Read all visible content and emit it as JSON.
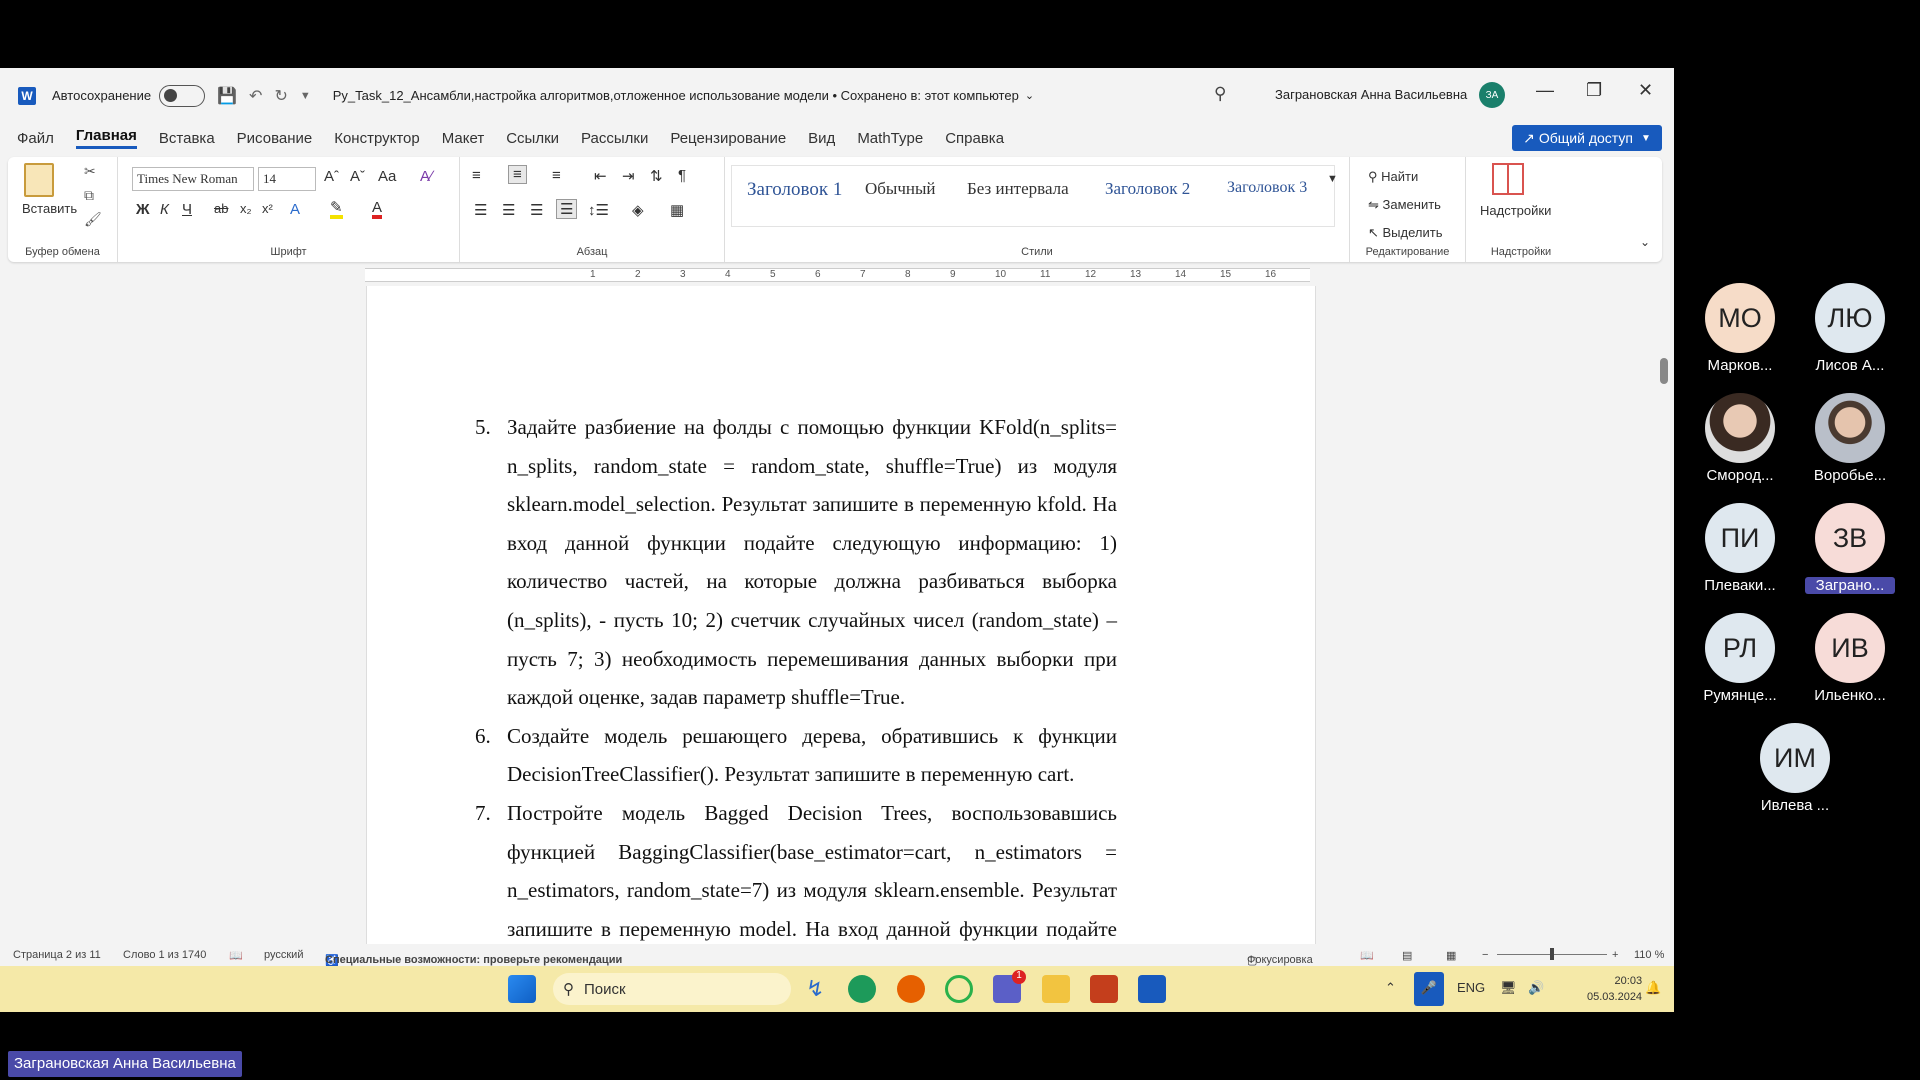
{
  "titlebar": {
    "app_icon": "W",
    "autosave_label": "Автосохранение",
    "doc_title": "Py_Task_12_Ансамбли,настройка алгоритмов,отложенное использование модели • Сохранено в: этот компьютер",
    "user_name": "Заграновская Анна Васильевна",
    "user_initials": "ЗА"
  },
  "menu": {
    "tabs": [
      "Файл",
      "Главная",
      "Вставка",
      "Рисование",
      "Конструктор",
      "Макет",
      "Ссылки",
      "Рассылки",
      "Рецензирование",
      "Вид",
      "MathType",
      "Справка"
    ],
    "share": "Общий доступ"
  },
  "ribbon": {
    "clipboard": {
      "paste": "Вставить",
      "label": "Буфер обмена"
    },
    "font": {
      "name": "Times New Roman",
      "size": "14",
      "label": "Шрифт"
    },
    "paragraph": {
      "label": "Абзац"
    },
    "styles": {
      "label": "Стили",
      "items": [
        "Заголовок 1",
        "Обычный",
        "Без интервала",
        "Заголовок 2",
        "Заголовок 3"
      ]
    },
    "editing": {
      "label": "Редактирование",
      "find": "Найти",
      "replace": "Заменить",
      "select": "Выделить"
    },
    "addins": {
      "button": "Надстройки",
      "label": "Надстройки"
    }
  },
  "ruler": {
    "numbers": [
      "1",
      "2",
      "3",
      "4",
      "5",
      "6",
      "7",
      "8",
      "9",
      "10",
      "11",
      "12",
      "13",
      "14",
      "15",
      "16"
    ]
  },
  "document": {
    "item5": {
      "num": "5.",
      "text": "Задайте разбиение на фолды с помощью функции KFold(n_splits= n_splits, random_state = random_state, shuffle=True) из модуля sklearn.model_selection. Результат запишите в переменную kfold. На вход данной функции подайте следующую информацию: 1) количество частей, на которые должна разбиваться выборка (n_splits), - пусть 10; 2) счетчик случайных чисел (random_state) – пусть 7; 3) необходимость перемешивания данных выборки при каждой оценке, задав параметр shuffle=True."
    },
    "item6": {
      "num": "6.",
      "text": "Создайте модель решающего дерева, обратившись к функции DecisionTreeClassifier(). Результат запишите в переменную cart."
    },
    "item7": {
      "num": "7.",
      "text": "Постройте модель Bagged Decision Trees, воспользовавшись функцией BaggingClassifier(base_estimator=cart, n_estimators = n_estimators, random_state=7) из модуля sklearn.ensemble. Результат запишите в переменную model. На вход данной функции подайте следующую"
    }
  },
  "statusbar": {
    "page": "Страница 2 из 11",
    "words": "Слово 1 из 1740",
    "language": "русский",
    "accessibility": "Специальные возможности: проверьте рекомендации",
    "focus": "Фокусировка",
    "zoom": "110 %"
  },
  "taskbar": {
    "search": "Поиск",
    "lang": "ENG",
    "time": "20:03",
    "date": "05.03.2024",
    "teams_badge": "1"
  },
  "participants": [
    {
      "initials": "МО",
      "name": "Марков...",
      "color": "#f6dcc8"
    },
    {
      "initials": "ЛЮ",
      "name": "Лисов А...",
      "color": "#dfe8ef"
    },
    {
      "initials": "",
      "name": "Смород...",
      "color": "#d9cfc6"
    },
    {
      "initials": "",
      "name": "Воробье...",
      "color": "#c9ccd3"
    },
    {
      "initials": "ПИ",
      "name": "Плеваки...",
      "color": "#dfe8ef"
    },
    {
      "initials": "ЗВ",
      "name": "Заграно...",
      "color": "#f7dcd8"
    },
    {
      "initials": "РЛ",
      "name": "Румянце...",
      "color": "#dfe8ef"
    },
    {
      "initials": "ИВ",
      "name": "Ильенко...",
      "color": "#f7dcd8"
    },
    {
      "initials": "ИМ",
      "name": "Ивлева ...",
      "color": "#dfe8ef"
    }
  ],
  "speaker_label": "Заграновская Анна Васильевна",
  "colors": {
    "accent": "#185abd",
    "taskbar": "#f5e9a8",
    "speaker": "#4a4aa8"
  }
}
